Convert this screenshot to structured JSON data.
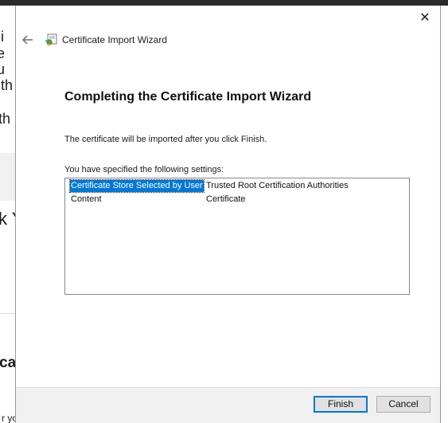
{
  "background": {
    "fragments": [
      "tei",
      "ue",
      "hu",
      "e th",
      "th",
      "k Y",
      "ca",
      "r yo"
    ]
  },
  "dialog": {
    "title": "Certificate Import Wizard",
    "close_glyph": "✕",
    "back_icon": "back-arrow-icon",
    "wizard_icon": "certificate-icon",
    "heading": "Completing the Certificate Import Wizard",
    "info": "The certificate will be imported after you click Finish.",
    "settings_label": "You have specified the following settings:",
    "settings": [
      {
        "name": "Certificate Store Selected by User",
        "value": "Trusted Root Certification Authorities",
        "selected": true
      },
      {
        "name": "Content",
        "value": "Certificate",
        "selected": false
      }
    ],
    "buttons": {
      "finish": "Finish",
      "cancel": "Cancel"
    }
  },
  "colors": {
    "accent": "#0078d7",
    "footer": "#f0f0f0"
  }
}
